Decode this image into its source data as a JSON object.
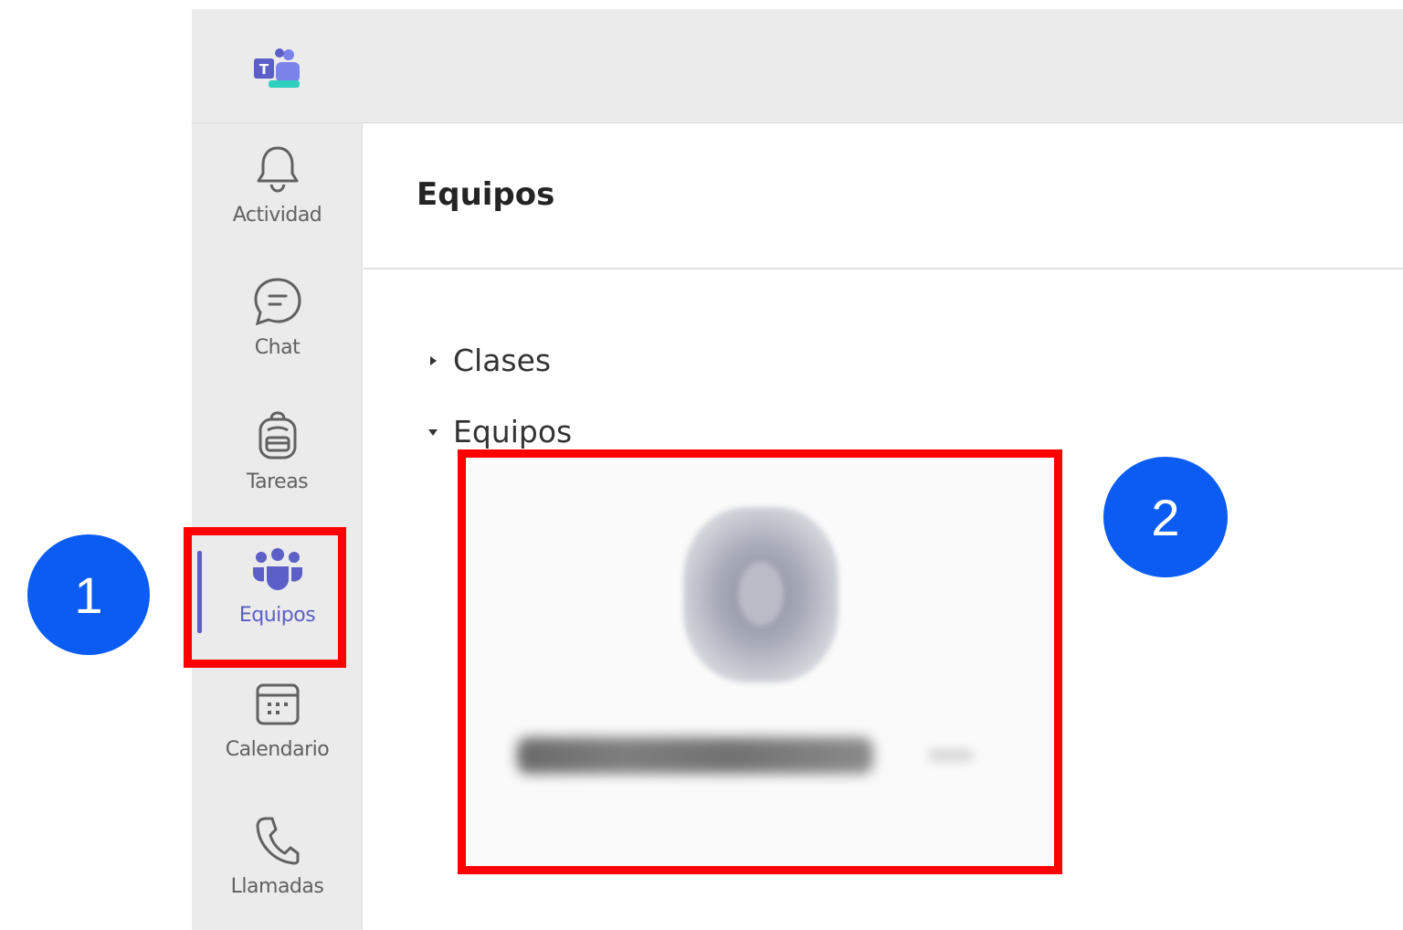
{
  "app": {
    "logo_icon": "teams-logo-icon",
    "brand_color": "#5b5fc7"
  },
  "rail": {
    "items": [
      {
        "label": "Actividad",
        "icon": "bell-icon"
      },
      {
        "label": "Chat",
        "icon": "chat-icon"
      },
      {
        "label": "Tareas",
        "icon": "backpack-icon"
      },
      {
        "label": "Equipos",
        "icon": "teams-icon",
        "active": true
      },
      {
        "label": "Calendario",
        "icon": "calendar-icon"
      },
      {
        "label": "Llamadas",
        "icon": "phone-icon"
      }
    ]
  },
  "main": {
    "title": "Equipos",
    "groups": [
      {
        "label": "Clases",
        "expanded": false
      },
      {
        "label": "Equipos",
        "expanded": true
      }
    ]
  },
  "annotations": {
    "step1": "1",
    "step2": "2",
    "highlight_color": "#ff0000",
    "badge_color": "#0a5cf2"
  }
}
